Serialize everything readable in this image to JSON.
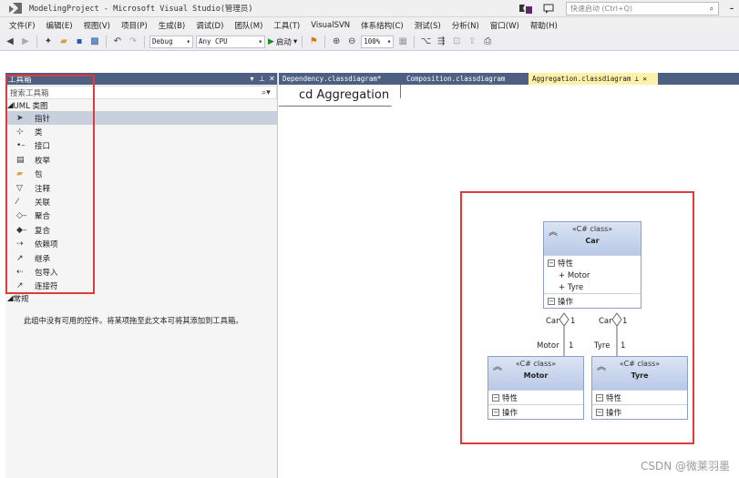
{
  "window": {
    "title": "ModelingProject - Microsoft Visual Studio(管理员)",
    "notification_count": "1",
    "quick_launch_placeholder": "快速启动 (Ctrl+Q)"
  },
  "menu": [
    "文件(F)",
    "编辑(E)",
    "视图(V)",
    "项目(P)",
    "生成(B)",
    "调试(D)",
    "团队(M)",
    "工具(T)",
    "VisualSVN",
    "体系结构(C)",
    "测试(S)",
    "分析(N)",
    "窗口(W)",
    "帮助(H)"
  ],
  "toolbar": {
    "config": "Debug",
    "platform": "Any CPU",
    "start": "启动",
    "zoom": "100%"
  },
  "toolbox": {
    "title": "工具箱",
    "search_placeholder": "搜索工具箱",
    "group_uml": "UML 类图",
    "items": [
      {
        "icon": "pointer-icon",
        "label": "指针"
      },
      {
        "icon": "class-icon",
        "label": "类"
      },
      {
        "icon": "interface-icon",
        "label": "接口"
      },
      {
        "icon": "enum-icon",
        "label": "枚举"
      },
      {
        "icon": "package-icon",
        "label": "包"
      },
      {
        "icon": "comment-icon",
        "label": "注释"
      },
      {
        "icon": "association-icon",
        "label": "关联"
      },
      {
        "icon": "aggregation-icon",
        "label": "聚合"
      },
      {
        "icon": "composition-icon",
        "label": "复合"
      },
      {
        "icon": "dependency-icon",
        "label": "依赖项"
      },
      {
        "icon": "inheritance-icon",
        "label": "继承"
      },
      {
        "icon": "package-import-icon",
        "label": "包导入"
      },
      {
        "icon": "connector-icon",
        "label": "连接符"
      }
    ],
    "group_general": "常规",
    "empty_message": "此组中没有可用的控件。将某项拖至此文本可将其添加到工具箱。"
  },
  "tabs": [
    {
      "label": "Dependency.classdiagram*",
      "active": false
    },
    {
      "label": "Composition.classdiagram",
      "active": false
    },
    {
      "label": "Aggregation.classdiagram",
      "active": true
    }
  ],
  "diagram": {
    "frame_label": "cd Aggregation",
    "stereotype": "«C# class»",
    "attributes_label": "特性",
    "operations_label": "操作",
    "car": {
      "name": "Car",
      "members": [
        "+ Motor",
        "+ Tyre"
      ]
    },
    "motor": {
      "name": "Motor"
    },
    "tyre": {
      "name": "Tyre"
    },
    "relations": [
      {
        "source": "Car",
        "source_mult": "1",
        "target": "Motor",
        "target_mult": "1"
      },
      {
        "source": "Car",
        "source_mult": "1",
        "target": "Tyre",
        "target_mult": "1"
      }
    ]
  },
  "watermark": "CSDN @微莱羽墨",
  "colors": {
    "highlight": "#e03a3a",
    "panel_header": "#4d6082",
    "active_tab": "#fff1a8"
  }
}
